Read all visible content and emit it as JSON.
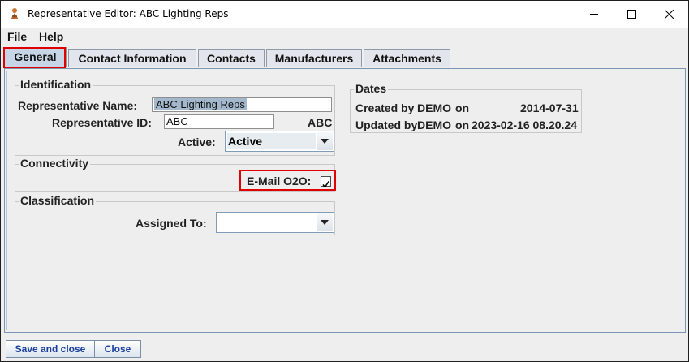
{
  "window": {
    "title": "Representative Editor: ABC Lighting Reps",
    "app_icon": "figure-icon"
  },
  "menu": {
    "file": "File",
    "help": "Help"
  },
  "tabs": [
    {
      "label": "General",
      "active": true
    },
    {
      "label": "Contact Information",
      "active": false
    },
    {
      "label": "Contacts",
      "active": false
    },
    {
      "label": "Manufacturers",
      "active": false
    },
    {
      "label": "Attachments",
      "active": false
    }
  ],
  "identification": {
    "title": "Identification",
    "name_label": "Representative Name:",
    "name_value": "ABC Lighting Reps",
    "id_label": "Representative ID:",
    "id_value": "ABC",
    "id_display": "ABC",
    "active_label": "Active:",
    "active_value": "Active"
  },
  "connectivity": {
    "title": "Connectivity",
    "email_label": "E-Mail O2O:",
    "email_checked": true
  },
  "classification": {
    "title": "Classification",
    "assigned_label": "Assigned To:",
    "assigned_value": ""
  },
  "dates": {
    "title": "Dates",
    "created_label": "Created by",
    "created_by": "DEMO",
    "created_on": "on",
    "created_date": "2014-07-31",
    "updated_label": "Updated by",
    "updated_by": "DEMO",
    "updated_on": "on",
    "updated_date": "2023-02-16 08.20.24"
  },
  "buttons": {
    "save_close": "Save and close",
    "close": "Close"
  },
  "colors": {
    "highlight": "#e00000",
    "active_tab": "#c7d6e6",
    "button_text": "#1b3f9a"
  }
}
